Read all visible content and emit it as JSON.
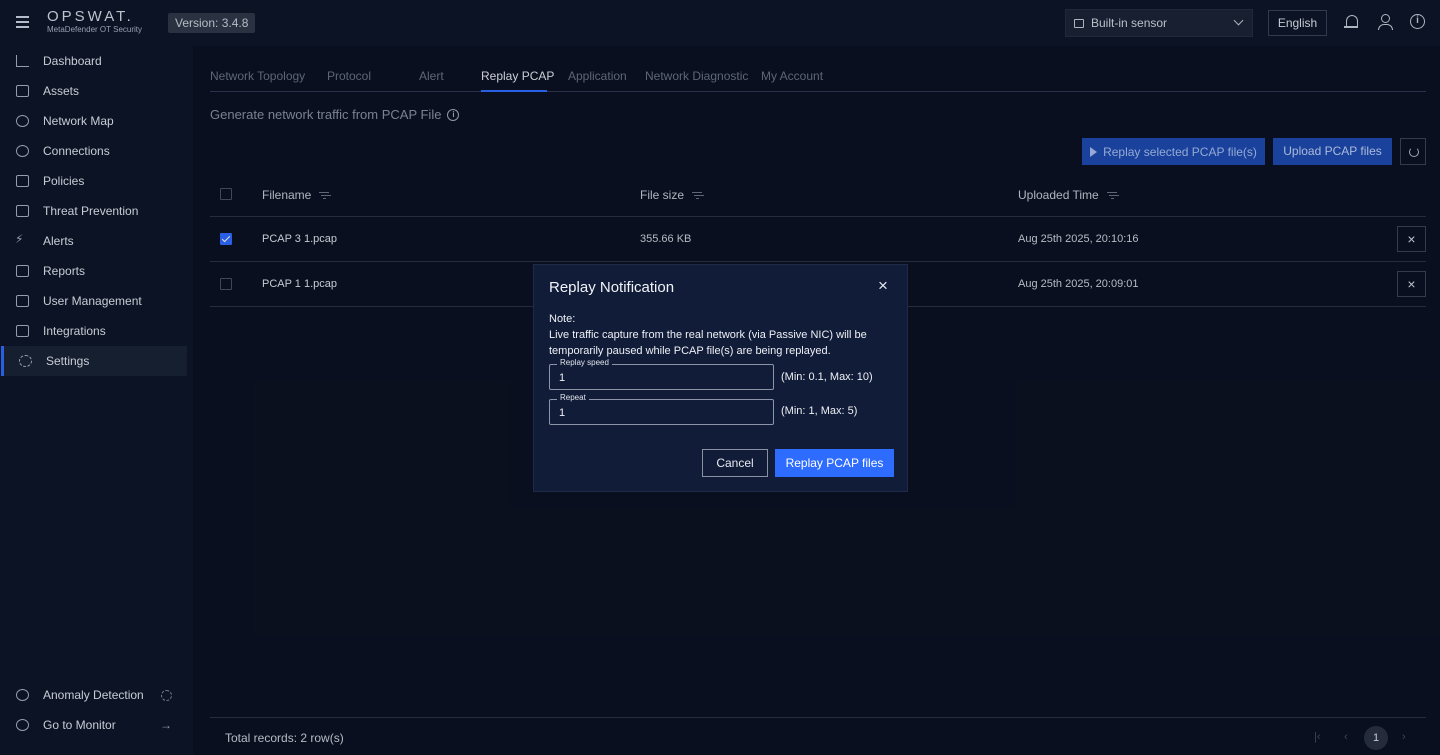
{
  "header": {
    "logo_main": "OPSWAT.",
    "logo_sub": "MetaDefender OT Security",
    "version": "Version: 3.4.8",
    "sensor": "Built-in sensor",
    "language": "English"
  },
  "sidebar": {
    "items": [
      {
        "label": "Dashboard",
        "icon": "chart-line-icon"
      },
      {
        "label": "Assets",
        "icon": "devices-icon"
      },
      {
        "label": "Network Map",
        "icon": "network-map-icon"
      },
      {
        "label": "Connections",
        "icon": "connections-icon"
      },
      {
        "label": "Policies",
        "icon": "clipboard-icon"
      },
      {
        "label": "Threat Prevention",
        "icon": "shield-file-icon"
      },
      {
        "label": "Alerts",
        "icon": "bolt-icon"
      },
      {
        "label": "Reports",
        "icon": "report-icon"
      },
      {
        "label": "User Management",
        "icon": "users-list-icon"
      },
      {
        "label": "Integrations",
        "icon": "grid-icon"
      },
      {
        "label": "Settings",
        "icon": "gear-icon",
        "active": true
      }
    ],
    "bottom": [
      {
        "label": "Anomaly Detection",
        "icon": "anomaly-icon"
      },
      {
        "label": "Go to Monitor",
        "icon": "eye-icon",
        "trail": "→"
      }
    ]
  },
  "tabs": [
    "Network Topology",
    "Protocol",
    "Alert",
    "Replay PCAP",
    "Application",
    "Network Diagnostic",
    "My Account"
  ],
  "active_tab": "Replay PCAP",
  "page": {
    "subtitle": "Generate network traffic from PCAP File",
    "replay_button": "Replay selected PCAP file(s)",
    "upload_button": "Upload PCAP files"
  },
  "table": {
    "columns": [
      "Filename",
      "File size",
      "Uploaded Time"
    ],
    "rows": [
      {
        "filename": "PCAP 3 1.pcap",
        "size": "355.66 KB",
        "time": "Aug 25th 2025, 20:10:16",
        "checked": true
      },
      {
        "filename": "PCAP 1 1.pcap",
        "size": "",
        "time": "Aug 25th 2025, 20:09:01",
        "checked": false
      }
    ],
    "delete_glyph": "×"
  },
  "footer": {
    "total": "Total records: 2 row(s)",
    "current_page": "1"
  },
  "modal": {
    "title": "Replay Notification",
    "close_glyph": "×",
    "note_label": "Note:",
    "note_text": "Live traffic capture from the real network (via Passive NIC) will be temporarily paused while PCAP file(s) are being replayed.",
    "speed_label": "Replay speed",
    "speed_value": "1",
    "speed_hint": "(Min: 0.1, Max: 10)",
    "repeat_label": "Repeat",
    "repeat_value": "1",
    "repeat_hint": "(Min: 1, Max: 5)",
    "cancel": "Cancel",
    "confirm": "Replay PCAP files"
  },
  "colors": {
    "accent": "#2f6bff",
    "background": "#0b1120",
    "modal_bg": "#111c38"
  }
}
